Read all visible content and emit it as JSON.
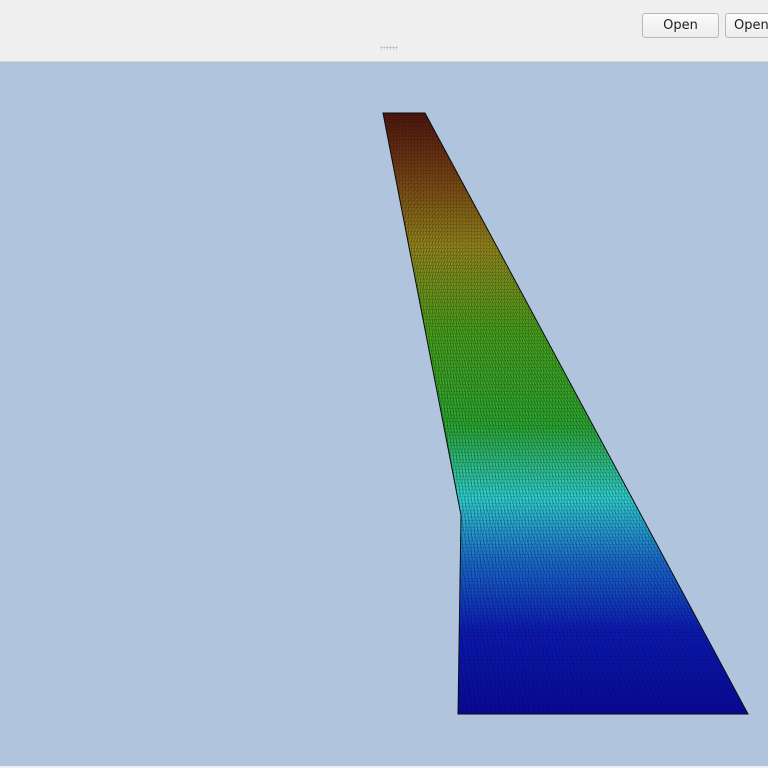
{
  "toolbar": {
    "open_button_label": "Open",
    "open_button_2_label": "Open"
  },
  "viewport": {
    "background_color": "#b0c4de",
    "mesh_colormap": [
      "#0a0aa8",
      "#1a3fc8",
      "#2fd6d6",
      "#2eb82e",
      "#5aa81a",
      "#a8a01a",
      "#8a5a14",
      "#6b1a10"
    ],
    "mesh_line_color": "#101010"
  }
}
